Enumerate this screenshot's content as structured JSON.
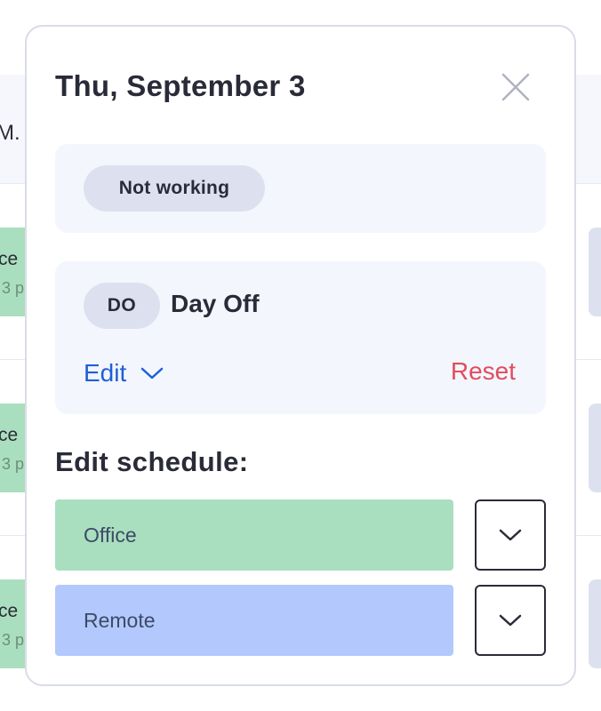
{
  "background": {
    "header_partial": "M. Y",
    "rows": [
      {
        "title": "ce",
        "subtitle": "3 p"
      },
      {
        "title": "ce",
        "subtitle": "3 p"
      },
      {
        "title": "ce",
        "subtitle": "3 p"
      }
    ]
  },
  "modal": {
    "title": "Thu, September 3",
    "close_icon": "close-icon",
    "status": {
      "label": "Not working"
    },
    "day_off": {
      "code": "DO",
      "label": "Day Off",
      "edit_label": "Edit",
      "edit_icon": "chevron-down-icon",
      "reset_label": "Reset"
    },
    "edit_schedule": {
      "title": "Edit schedule:",
      "options": [
        {
          "label": "Office",
          "color": "#a9dfbf"
        },
        {
          "label": "Remote",
          "color": "#b3c9fd"
        }
      ]
    }
  },
  "colors": {
    "accent_blue": "#1f5fd6",
    "reset_red": "#e24d5c",
    "card_background": "#f3f6fd",
    "pill_background": "#dde1ef"
  }
}
